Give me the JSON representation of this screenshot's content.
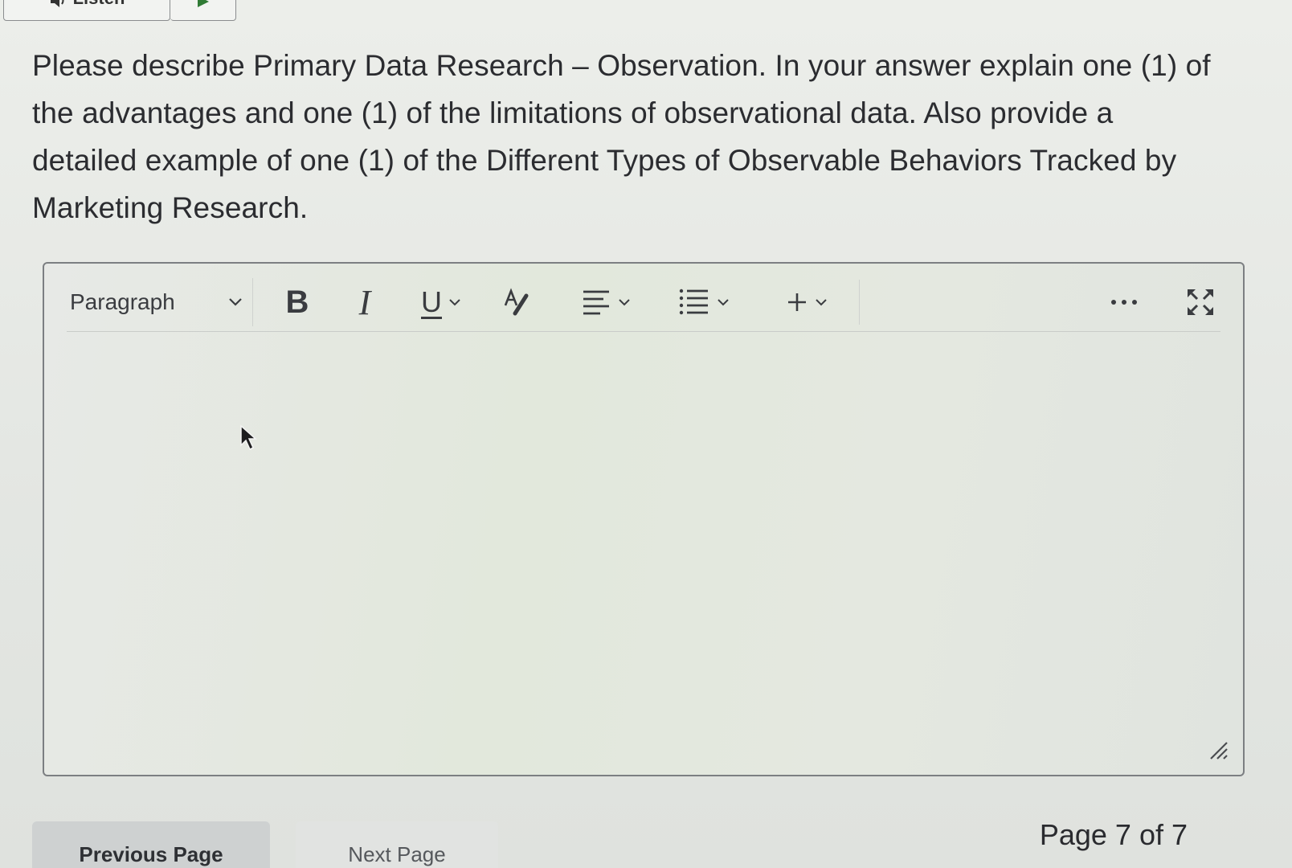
{
  "top": {
    "listen_label": "Listen"
  },
  "question": {
    "text": "Please describe Primary Data Research – Observation.    In your answer explain one (1) of the advantages and one (1) of the limitations of observational data.  Also provide a detailed example of one (1) of the Different Types of Observable Behaviors Tracked by Marketing Research."
  },
  "editor": {
    "format_label": "Paragraph",
    "bold_label": "B",
    "italic_label": "I",
    "underline_label": "U",
    "content": ""
  },
  "navigation": {
    "previous_label": "Previous Page",
    "next_label": "Next Page",
    "page_indicator": "Page 7 of 7"
  },
  "colors": {
    "icon": "#3a3c40",
    "border": "#7c7f82"
  }
}
